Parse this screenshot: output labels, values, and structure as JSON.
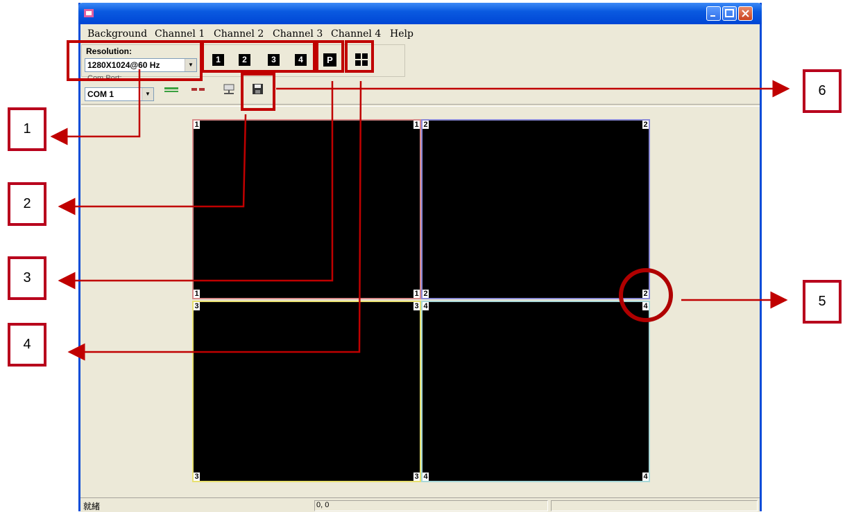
{
  "menu": [
    "Background",
    "Channel 1",
    "Channel 2",
    "Channel 3",
    "Channel 4",
    "Help"
  ],
  "toolbar": {
    "resolution_label": "Resolution:",
    "resolution_value": "1280X1024@60 Hz",
    "comport_label": "Com Port:",
    "comport_value": "COM 1",
    "channel_buttons": [
      "1",
      "2",
      "3",
      "4"
    ],
    "p_button": "P"
  },
  "panels": [
    {
      "label": "1",
      "color": "#d88a8a"
    },
    {
      "label": "2",
      "color": "#8a8ad8"
    },
    {
      "label": "3",
      "color": "#e8e070"
    },
    {
      "label": "4",
      "color": "#a8d8d8"
    }
  ],
  "status": {
    "ready": "就緒",
    "coords": "0, 0"
  },
  "callouts": [
    "1",
    "2",
    "3",
    "4",
    "5",
    "6"
  ],
  "colors": {
    "annotation": "#c00000",
    "window_bg": "#ece9d8",
    "titlebar": "#0a5ae0"
  }
}
